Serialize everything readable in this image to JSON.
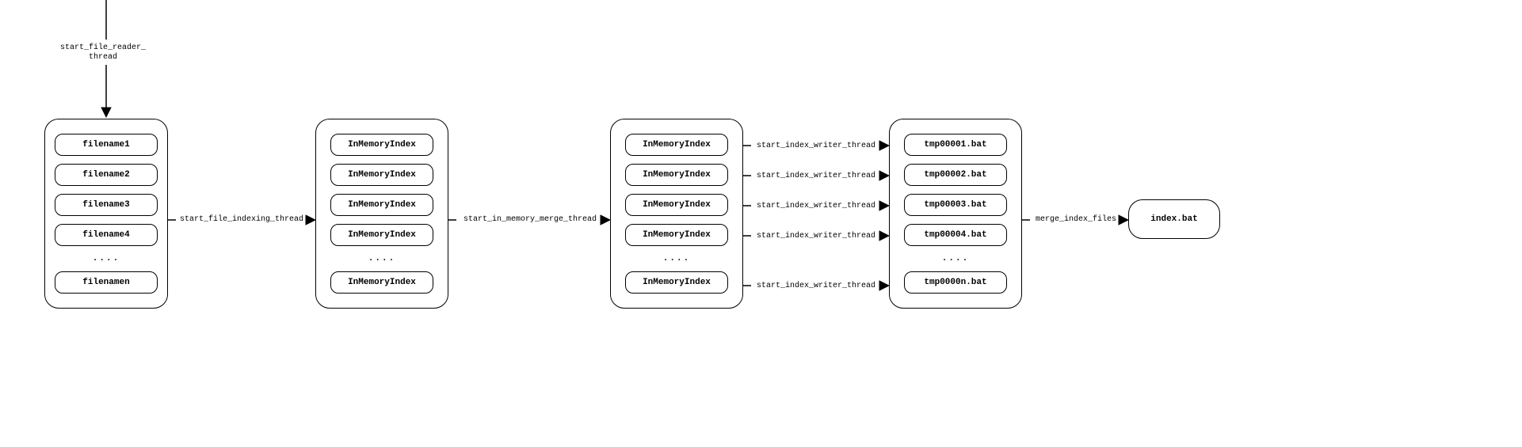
{
  "labels": {
    "top_arrow": "start_file_reader_\nthread",
    "arrow12": "start_file_indexing_thread",
    "arrow23": "start_in_memory_merge_thread",
    "arrow34": "start_index_writer_thread",
    "arrow45": "merge_index_files"
  },
  "col1": {
    "items": [
      "filename1",
      "filename2",
      "filename3",
      "filename4"
    ],
    "dots": "....",
    "last": "filenamen"
  },
  "col2": {
    "items": [
      "InMemoryIndex",
      "InMemoryIndex",
      "InMemoryIndex",
      "InMemoryIndex"
    ],
    "dots": "....",
    "last": "InMemoryIndex"
  },
  "col3": {
    "items": [
      "InMemoryIndex",
      "InMemoryIndex",
      "InMemoryIndex",
      "InMemoryIndex"
    ],
    "dots": "....",
    "last": "InMemoryIndex"
  },
  "col4": {
    "items": [
      "tmp00001.bat",
      "tmp00002.bat",
      "tmp00003.bat",
      "tmp00004.bat"
    ],
    "dots": "....",
    "last": "tmp0000n.bat"
  },
  "final": "index.bat"
}
